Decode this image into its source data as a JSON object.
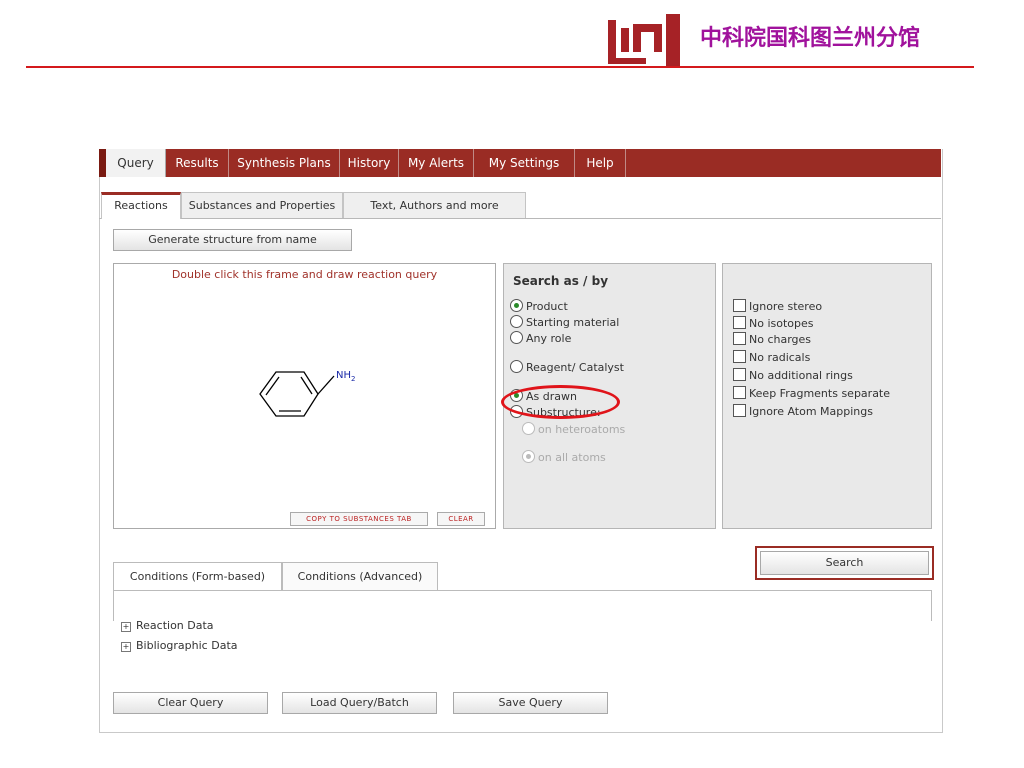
{
  "header": {
    "org_name": "中科院国科图兰州分馆",
    "logo_icon": "library-logo",
    "colors": {
      "logo": "#a62226",
      "org_text": "#a0129c",
      "rule": "#d4191c"
    }
  },
  "menu": {
    "tabs": [
      {
        "label": "Query",
        "active": true
      },
      {
        "label": "Results"
      },
      {
        "label": "Synthesis Plans"
      },
      {
        "label": "History"
      },
      {
        "label": "My Alerts"
      },
      {
        "label": "My Settings"
      },
      {
        "label": "Help"
      }
    ],
    "color": "#9a2c24"
  },
  "subtabs": [
    {
      "label": "Reactions",
      "active": true
    },
    {
      "label": "Substances and Properties"
    },
    {
      "label": "Text, Authors and more"
    }
  ],
  "generate_button": "Generate structure from name",
  "drawing": {
    "hint": "Double click this frame and draw reaction query",
    "substituent": "NH",
    "substituent_sub": "2",
    "copy_button": "COPY TO SUBSTANCES TAB",
    "clear_button": "CLEAR"
  },
  "search_as": {
    "title": "Search as / by",
    "options": [
      {
        "label": "Product",
        "selected": true
      },
      {
        "label": "Starting material"
      },
      {
        "label": "Any role"
      },
      {
        "label": "Reagent/ Catalyst"
      },
      {
        "label": "As drawn",
        "selected": true
      },
      {
        "label": "Substructure:"
      },
      {
        "label": "on heteroatoms",
        "disabled": true
      },
      {
        "label": "on all atoms",
        "disabled": true,
        "selected": true
      }
    ]
  },
  "options": [
    "Ignore stereo",
    "No isotopes",
    "No charges",
    "No radicals",
    "No additional rings",
    "Keep Fragments separate",
    "Ignore Atom Mappings"
  ],
  "search_button": "Search",
  "condition_tabs": [
    "Conditions (Form-based)",
    "Conditions (Advanced)"
  ],
  "expandables": [
    "Reaction Data",
    "Bibliographic Data"
  ],
  "bottom_buttons": {
    "clear": "Clear Query",
    "load": "Load Query/Batch",
    "save": "Save Query"
  }
}
